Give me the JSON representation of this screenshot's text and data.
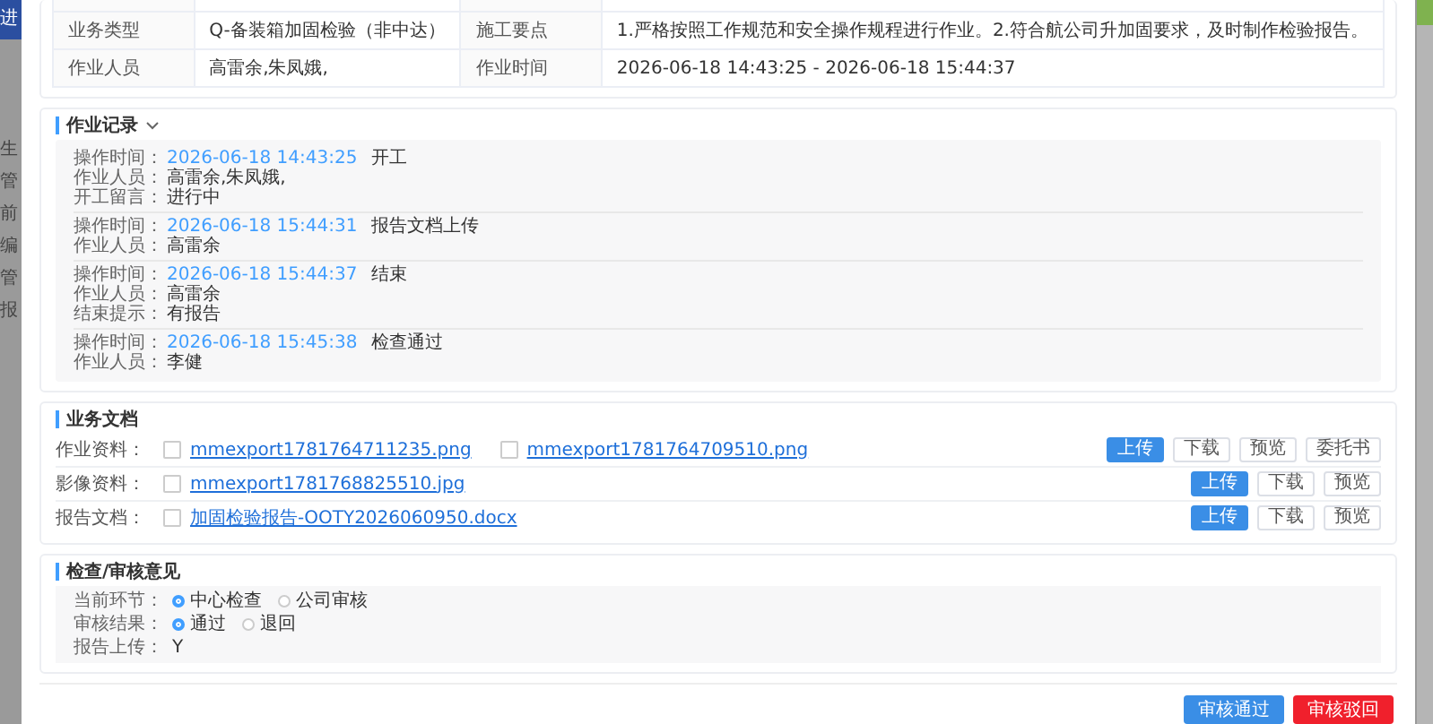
{
  "background_menu": [
    {
      "label": "进",
      "selected": true
    },
    {
      "label": "生",
      "selected": false
    },
    {
      "label": "管",
      "selected": false
    },
    {
      "label": "前",
      "selected": false
    },
    {
      "label": "编",
      "selected": false
    },
    {
      "label": "管",
      "selected": false
    },
    {
      "label": "报",
      "selected": false
    }
  ],
  "info_table": {
    "rows": [
      {
        "label_1": "业务类型",
        "value_1": "Q-备装箱加固检验（非中达）",
        "label_2": "施工要点",
        "value_2": "1.严格按照工作规范和安全操作规程进行作业。2.符合航公司升加固要求，及时制作检验报告。"
      },
      {
        "label_1": "作业人员",
        "value_1": "高雷余,朱凤娥,",
        "label_2": "作业时间",
        "value_2": "2026-06-18 14:43:25 - 2026-06-18 15:44:37"
      }
    ]
  },
  "work_records": {
    "title": "作业记录",
    "expanded": true,
    "records": [
      {
        "time_label": "操作时间：",
        "time": "2026-06-18 14:43:25",
        "action": "开工",
        "lines": [
          {
            "label": "作业人员：",
            "value": "高雷余,朱凤娥,"
          },
          {
            "label": "开工留言：",
            "value": "进行中"
          }
        ]
      },
      {
        "time_label": "操作时间：",
        "time": "2026-06-18 15:44:31",
        "action": "报告文档上传",
        "lines": [
          {
            "label": "作业人员：",
            "value": "高雷余"
          }
        ]
      },
      {
        "time_label": "操作时间：",
        "time": "2026-06-18 15:44:37",
        "action": "结束",
        "lines": [
          {
            "label": "作业人员：",
            "value": "高雷余"
          },
          {
            "label": "结束提示：",
            "value": "有报告"
          }
        ]
      },
      {
        "time_label": "操作时间：",
        "time": "2026-06-18 15:45:38",
        "action": "检查通过",
        "lines": [
          {
            "label": "作业人员：",
            "value": "李健"
          }
        ]
      }
    ]
  },
  "documents": {
    "title": "业务文档",
    "rows": [
      {
        "label": "作业资料：",
        "files": [
          {
            "name": "mmexport1781764711235.png",
            "checked": false
          },
          {
            "name": "mmexport1781764709510.png",
            "checked": false
          }
        ],
        "buttons": [
          {
            "label": "上传",
            "kind": "upload"
          },
          {
            "label": "下载",
            "kind": "download"
          },
          {
            "label": "预览",
            "kind": "preview"
          },
          {
            "label": "委托书",
            "kind": "authorization"
          }
        ]
      },
      {
        "label": "影像资料：",
        "files": [
          {
            "name": "mmexport1781768825510.jpg",
            "checked": false
          }
        ],
        "buttons": [
          {
            "label": "上传",
            "kind": "upload"
          },
          {
            "label": "下载",
            "kind": "download"
          },
          {
            "label": "预览",
            "kind": "preview"
          }
        ]
      },
      {
        "label": "报告文档：",
        "files": [
          {
            "name": "加固检验报告-OOTY2026060950.docx",
            "checked": false
          }
        ],
        "buttons": [
          {
            "label": "上传",
            "kind": "upload"
          },
          {
            "label": "下载",
            "kind": "download"
          },
          {
            "label": "预览",
            "kind": "preview"
          }
        ]
      }
    ]
  },
  "review": {
    "title": "检查/审核意见",
    "rows": [
      {
        "kind": "radio",
        "label": "当前环节：",
        "options": [
          {
            "label": "中心检查",
            "selected": true
          },
          {
            "label": "公司审核",
            "selected": false
          }
        ]
      },
      {
        "kind": "radio",
        "label": "审核结果：",
        "options": [
          {
            "label": "通过",
            "selected": true
          },
          {
            "label": "退回",
            "selected": false
          }
        ]
      },
      {
        "kind": "text",
        "label": "报告上传：",
        "value": "Y"
      }
    ]
  },
  "footer_buttons": [
    {
      "label": "审核通过",
      "kind": "approve"
    },
    {
      "label": "审核驳回",
      "kind": "reject"
    }
  ]
}
